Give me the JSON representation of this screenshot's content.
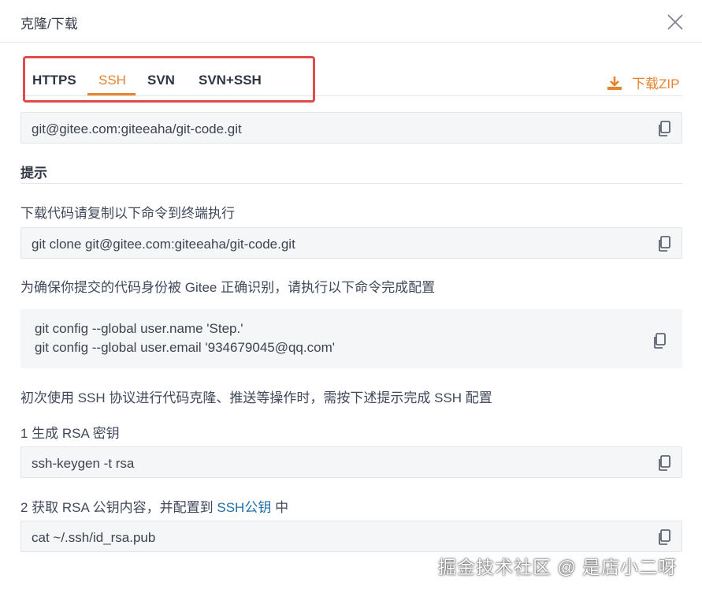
{
  "dialog": {
    "title": "克隆/下载",
    "close_icon": "close-icon"
  },
  "tabs": [
    {
      "label": "HTTPS",
      "active": false
    },
    {
      "label": "SSH",
      "active": true
    },
    {
      "label": "SVN",
      "active": false
    },
    {
      "label": "SVN+SSH",
      "active": false
    }
  ],
  "download_zip": {
    "label": "下载ZIP",
    "icon": "download-icon"
  },
  "repo_url": "git@gitee.com:giteeaha/git-code.git",
  "tips": {
    "title": "提示",
    "clone_hint": "下载代码请复制以下命令到终端执行",
    "clone_command": "git clone git@gitee.com:giteeaha/git-code.git",
    "config_hint": "为确保你提交的代码身份被 Gitee 正确识别，请执行以下命令完成配置",
    "config_lines": [
      "git config --global user.name 'Step.'",
      "git config --global user.email '934679045@qq.com'"
    ],
    "ssh_hint": "初次使用 SSH 协议进行代码克隆、推送等操作时，需按下述提示完成 SSH 配置",
    "step1": "1 生成 RSA 密钥",
    "step1_command": "ssh-keygen -t rsa",
    "step2_prefix": "2 获取 RSA 公钥内容，并配置到 ",
    "step2_link": "SSH公钥",
    "step2_suffix": " 中",
    "step2_command": "cat ~/.ssh/id_rsa.pub"
  },
  "watermark": "掘金技术社区 @ 是店小二呀",
  "colors": {
    "accent": "#e6832f",
    "highlight": "#e24b4b",
    "link": "#1f6fa8",
    "code_bg": "#f5f6f7"
  }
}
